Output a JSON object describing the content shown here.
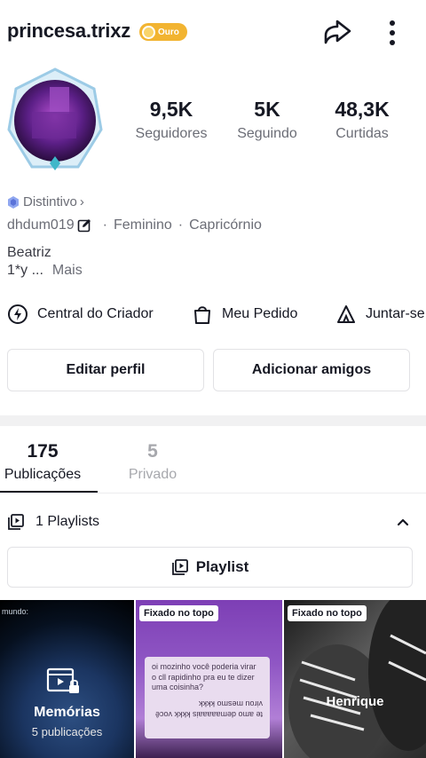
{
  "header": {
    "username": "princesa.trixz",
    "badge_label": "Ouro",
    "share_icon": "share-arrow-icon",
    "more_icon": "more-vertical-icon"
  },
  "profile": {
    "avatar_icon": "avatar",
    "stats": [
      {
        "value": "9,5K",
        "label": "Seguidores"
      },
      {
        "value": "5K",
        "label": "Seguindo"
      },
      {
        "value": "48,3K",
        "label": "Curtidas"
      }
    ],
    "distintivo": "Distintivo",
    "handle": "dhdum019",
    "gender": "Feminino",
    "sign": "Capricórnio",
    "bio_name": "Beatriz",
    "bio_line": "1*y ...",
    "bio_more": "Mais"
  },
  "shortcuts": [
    {
      "label": "Central do Criador",
      "icon": "creator-center-icon"
    },
    {
      "label": "Meu Pedido",
      "icon": "shopping-bag-icon"
    },
    {
      "label": "Juntar-se",
      "icon": "live-community-icon"
    }
  ],
  "actions": {
    "edit_profile": "Editar perfil",
    "add_friends": "Adicionar amigos"
  },
  "tabs": [
    {
      "count": "175",
      "label": "Publicações",
      "active": true
    },
    {
      "count": "5",
      "label": "Privado",
      "active": false
    }
  ],
  "playlists": {
    "summary": "1 Playlists",
    "button_label": "Playlist"
  },
  "grid": {
    "items": [
      {
        "corner_text": "mundo:",
        "title": "Memórias",
        "subtitle": "5 publicações"
      },
      {
        "pin": "Fixado no topo",
        "note": "oi mozinho você poderia virar o cll rapidinho pra eu te dizer uma coisinha?",
        "note_flipped": "te amo demaaaaais kkkk você virou mesmo kkkk"
      },
      {
        "pin": "Fixado no topo",
        "caption": "Henrique"
      }
    ]
  }
}
